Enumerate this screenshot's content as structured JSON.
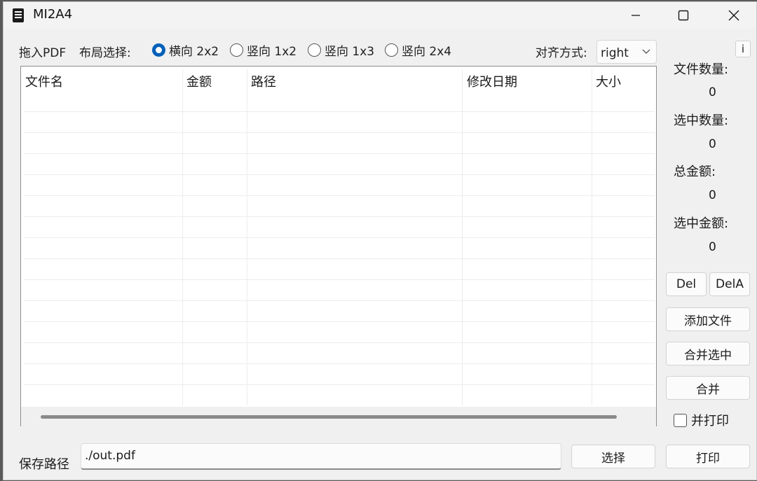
{
  "window": {
    "title": "MI2A4"
  },
  "toolbar": {
    "drag_hint": "拖入PDF",
    "layout_label": "布局选择:",
    "layout_options": [
      {
        "label": "横向 2x2",
        "checked": true
      },
      {
        "label": "竖向 1x2",
        "checked": false
      },
      {
        "label": "竖向 1x3",
        "checked": false
      },
      {
        "label": "竖向 2x4",
        "checked": false
      }
    ],
    "align_label": "对齐方式:",
    "align_value": "right",
    "info_label": "i"
  },
  "table": {
    "columns": [
      "文件名",
      "金额",
      "路径",
      "修改日期",
      "大小"
    ],
    "rows": []
  },
  "stats": {
    "file_count_label": "文件数量:",
    "file_count": "0",
    "selected_count_label": "选中数量:",
    "selected_count": "0",
    "total_amount_label": "总金额:",
    "total_amount": "0",
    "selected_amount_label": "选中金额:",
    "selected_amount": "0"
  },
  "actions": {
    "del": "Del",
    "del_all": "DelA",
    "add_files": "添加文件",
    "merge_selected": "合并选中",
    "merge": "合并",
    "print_too": "并打印",
    "print_too_checked": false
  },
  "save": {
    "label": "保存路径",
    "path": "./out.pdf",
    "choose": "选择",
    "print": "打印"
  },
  "colors": {
    "accent": "#005fb8",
    "window_bg": "#f0f0f0"
  }
}
